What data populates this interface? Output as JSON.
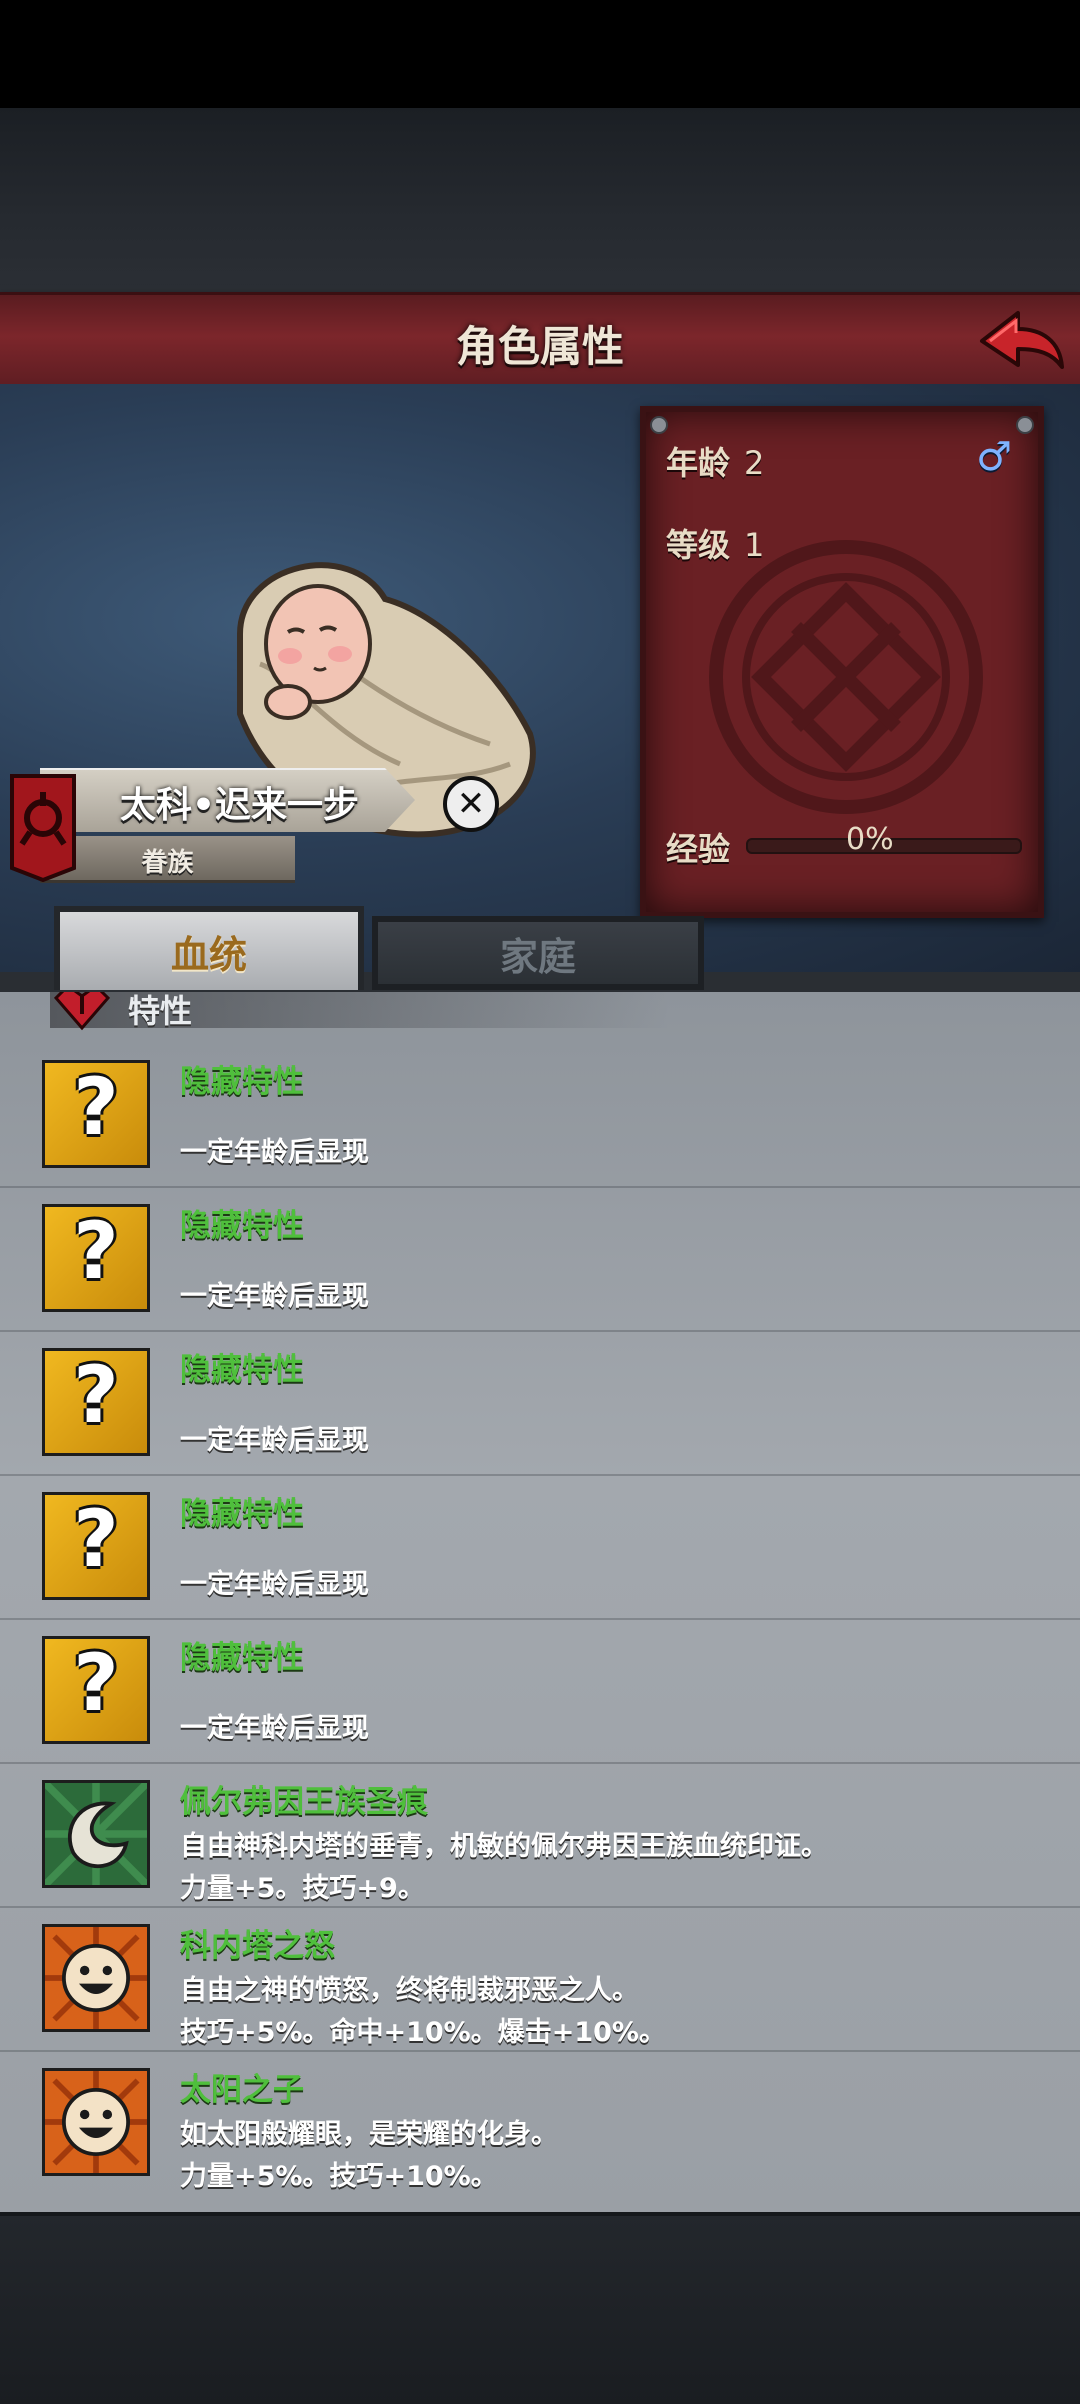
{
  "header": {
    "title": "角色属性"
  },
  "character": {
    "name": "太科•迟来一步",
    "family": "眷族",
    "stats": {
      "age_label": "年龄",
      "age": "2",
      "level_label": "等级",
      "level": "1",
      "gender_symbol": "♂"
    },
    "exp": {
      "label": "经验",
      "percent_text": "0%",
      "fraction": 0.0
    }
  },
  "tabs": [
    {
      "label": "血统",
      "active": true
    },
    {
      "label": "家庭",
      "active": false
    }
  ],
  "section": {
    "title": "特性"
  },
  "traits": [
    {
      "icon": "question-mark-icon",
      "name": "隐藏特性",
      "desc": "一定年龄后显现"
    },
    {
      "icon": "question-mark-icon",
      "name": "隐藏特性",
      "desc": "一定年龄后显现"
    },
    {
      "icon": "question-mark-icon",
      "name": "隐藏特性",
      "desc": "一定年龄后显现"
    },
    {
      "icon": "question-mark-icon",
      "name": "隐藏特性",
      "desc": "一定年龄后显现"
    },
    {
      "icon": "question-mark-icon",
      "name": "隐藏特性",
      "desc": "一定年龄后显现"
    },
    {
      "icon": "green-swirl-icon",
      "name": "佩尔弗因王族圣痕",
      "desc": "自由神科内塔的垂青，机敏的佩尔弗因王族血统印证。",
      "effect": "力量+5。技巧+9。"
    },
    {
      "icon": "smiling-sun-icon",
      "name": "科内塔之怒",
      "desc": "自由之神的愤怒，终将制裁邪恶之人。",
      "effect": "技巧+5%。命中+10%。爆击+10%。"
    },
    {
      "icon": "smiling-sun-icon",
      "name": "太阳之子",
      "desc": "如太阳般耀眼，是荣耀的化身。",
      "effect": "力量+5%。技巧+10%。"
    }
  ],
  "colors": {
    "title_bar": "#7c262b",
    "trait_name": "#4fbf3c",
    "panel": "#a3a8ae",
    "stat_panel": "#6a2024"
  }
}
